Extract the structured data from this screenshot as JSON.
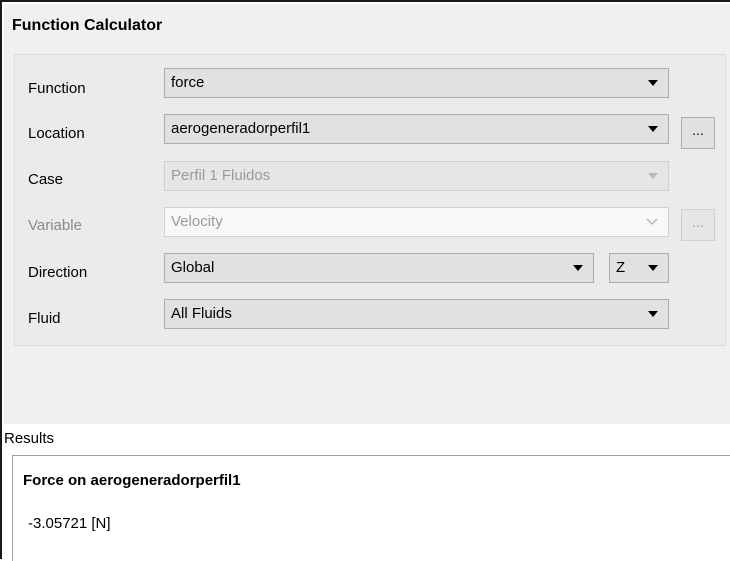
{
  "panel": {
    "title": "Function Calculator"
  },
  "rows": {
    "function": {
      "label": "Function",
      "value": "force"
    },
    "location": {
      "label": "Location",
      "value": "aerogeneradorperfil1",
      "button": "..."
    },
    "case": {
      "label": "Case",
      "value": "Perfil 1 Fluidos"
    },
    "variable": {
      "label": "Variable",
      "value": "Velocity",
      "button": "..."
    },
    "direction": {
      "label": "Direction",
      "value": "Global",
      "axis": "Z"
    },
    "fluid": {
      "label": "Fluid",
      "value": "All Fluids"
    }
  },
  "results": {
    "label": "Results",
    "title": "Force on aerogeneradorperfil1",
    "value": "-3.05721 [N]"
  },
  "icons": {
    "dropdown": "chevron-down-icon",
    "disabled_dropdown": "chevron-outline-icon"
  },
  "colors": {
    "panel_bg": "#f0f0f0",
    "combo_bg": "#e1e1e1",
    "disabled_text": "#9a9a9a"
  }
}
